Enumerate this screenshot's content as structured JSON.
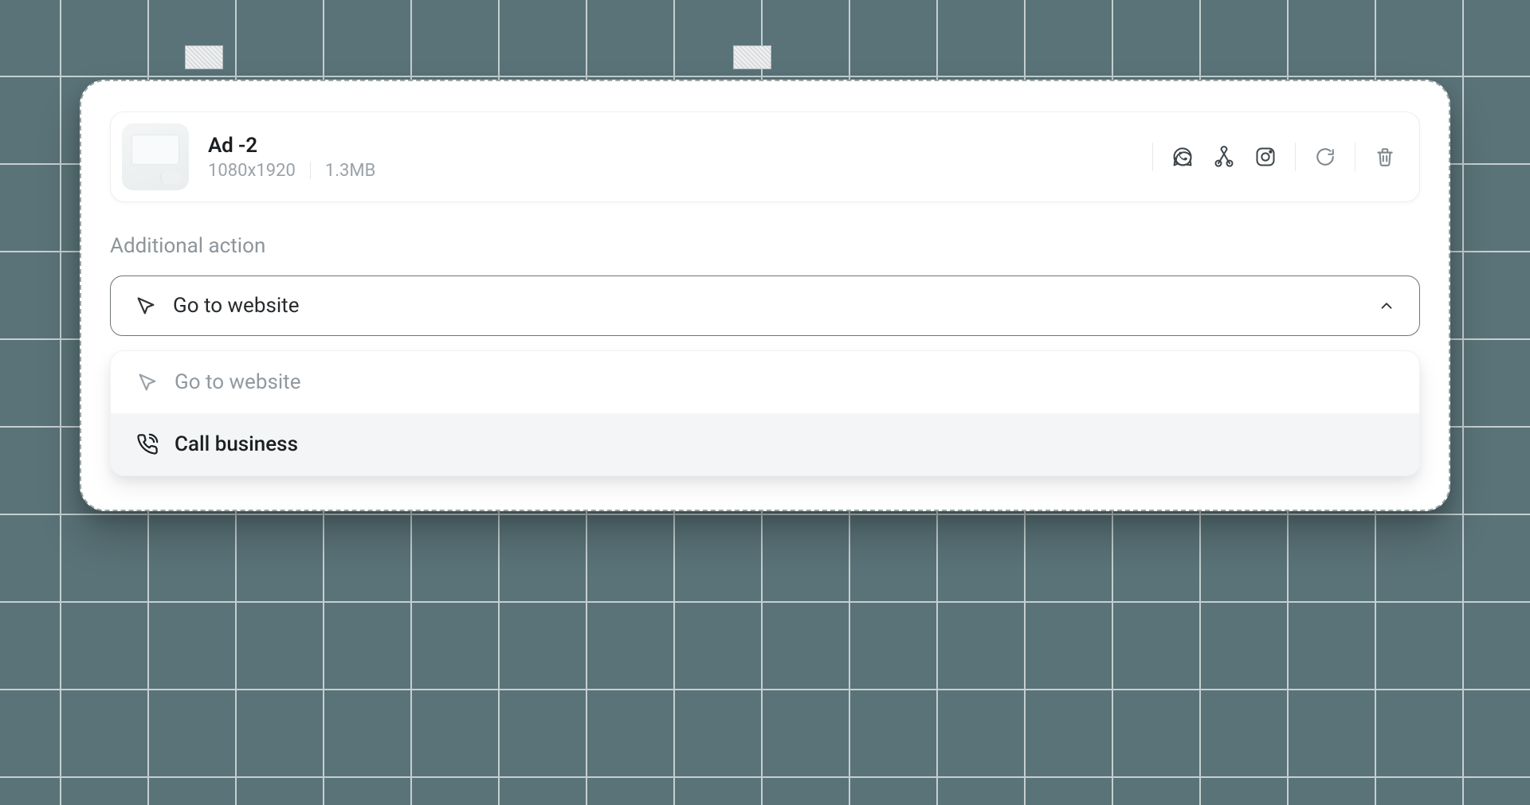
{
  "ad": {
    "title": "Ad -2",
    "dimensions": "1080x1920",
    "size": "1.3MB"
  },
  "channels": {
    "whatsapp": "whatsapp-icon",
    "google_ads": "google-ads-icon",
    "instagram": "instagram-icon"
  },
  "section": {
    "label": "Additional action"
  },
  "select": {
    "selected": "Go to website",
    "options": [
      {
        "label": "Go to website",
        "icon": "cursor"
      },
      {
        "label": "Call business",
        "icon": "phone"
      }
    ]
  }
}
